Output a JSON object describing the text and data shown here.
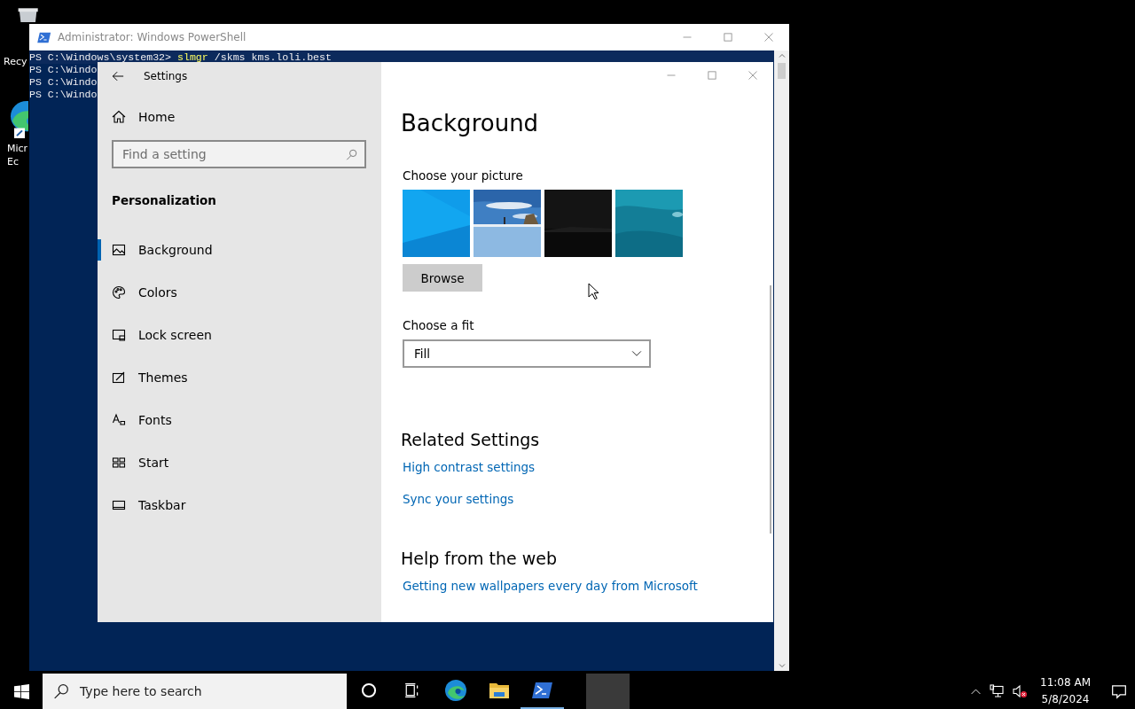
{
  "desktop_icons": [
    {
      "kind": "bin",
      "lines": [
        "Recy"
      ]
    },
    {
      "kind": "edge",
      "lines": [
        "Micr",
        "Ec"
      ]
    }
  ],
  "powershell": {
    "title": "Administrator: Windows PowerShell",
    "lines": [
      {
        "kind": "command",
        "prompt": "PS C:\\Windows\\system32>",
        "command": "slmgr",
        "args": "/skms kms.loli.best"
      },
      {
        "kind": "plain",
        "text": "PS C:\\Windo"
      },
      {
        "kind": "plain",
        "text": "PS C:\\Windo"
      },
      {
        "kind": "plain",
        "text": "PS C:\\Windo"
      }
    ]
  },
  "settings": {
    "title": "Settings",
    "home": "Home",
    "search": {
      "placeholder": "Find a setting"
    },
    "section": "Personalization",
    "nav": [
      {
        "kind": "picture",
        "label": "Background",
        "selected": true
      },
      {
        "kind": "palette",
        "label": "Colors",
        "selected": false
      },
      {
        "kind": "lock",
        "label": "Lock screen",
        "selected": false
      },
      {
        "kind": "brush",
        "label": "Themes",
        "selected": false
      },
      {
        "kind": "font",
        "label": "Fonts",
        "selected": false
      },
      {
        "kind": "start",
        "label": "Start",
        "selected": false
      },
      {
        "kind": "taskbar",
        "label": "Taskbar",
        "selected": false
      }
    ],
    "heading": "Background",
    "picture_label": "Choose your picture",
    "pictures": [
      {
        "kind": "picture"
      },
      {
        "kind": "picture"
      },
      {
        "kind": "picture"
      },
      {
        "kind": "picture"
      }
    ],
    "browse": "Browse",
    "fit_label": "Choose a fit",
    "fit": {
      "value": "Fill"
    },
    "related_heading": "Related Settings",
    "related_links": [
      "High contrast settings",
      "Sync your settings"
    ],
    "help_heading": "Help from the web",
    "help_links": [
      "Getting new wallpapers every day from Microsoft"
    ]
  },
  "taskbar": {
    "search": {
      "placeholder": "Type here to search"
    },
    "apps": [
      {
        "kind": "cortana",
        "running": false
      },
      {
        "kind": "taskview",
        "running": false
      },
      {
        "kind": "edge",
        "running": false
      },
      {
        "kind": "explorer",
        "running": false
      },
      {
        "kind": "powershell",
        "running": true
      },
      {
        "kind": "blank",
        "running": true
      }
    ],
    "time": "11:08 AM",
    "date": "5/8/2024"
  }
}
